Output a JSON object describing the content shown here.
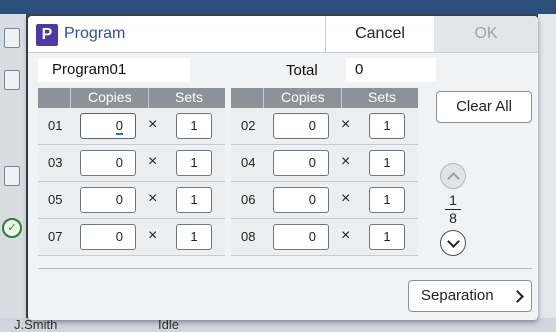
{
  "background": {
    "user": "J.Smith",
    "status": "Idle"
  },
  "dialog": {
    "app_icon": "P",
    "title": "Program",
    "cancel_label": "Cancel",
    "ok_label": "OK",
    "program_name": "Program01",
    "total_label": "Total",
    "total_value": "0",
    "columns": {
      "copies": "Copies",
      "sets": "Sets"
    },
    "rows": [
      {
        "num": "01",
        "copies": "0",
        "sets": "1"
      },
      {
        "num": "02",
        "copies": "0",
        "sets": "1"
      },
      {
        "num": "03",
        "copies": "0",
        "sets": "1"
      },
      {
        "num": "04",
        "copies": "0",
        "sets": "1"
      },
      {
        "num": "05",
        "copies": "0",
        "sets": "1"
      },
      {
        "num": "06",
        "copies": "0",
        "sets": "1"
      },
      {
        "num": "07",
        "copies": "0",
        "sets": "1"
      },
      {
        "num": "08",
        "copies": "0",
        "sets": "1"
      }
    ],
    "times_symbol": "×",
    "clear_all_label": "Clear All",
    "page_current": "1",
    "page_total": "8",
    "separation_label": "Separation"
  }
}
